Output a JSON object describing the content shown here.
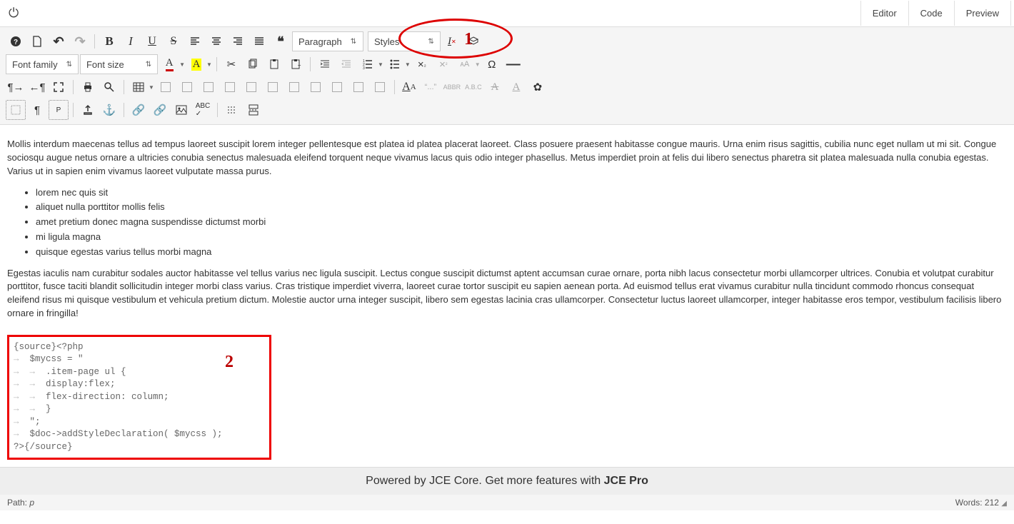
{
  "top": {
    "tabs": [
      "Editor",
      "Code",
      "Preview"
    ]
  },
  "toolbar": {
    "format_dropdown": "Paragraph",
    "styles_dropdown": "Styles",
    "font_family": "Font family",
    "font_size": "Font size",
    "abbr": "ABBR",
    "abc": "A.B.C",
    "quote_label": "“...”"
  },
  "annotations": {
    "circle_label": "1",
    "box_label": "2"
  },
  "content": {
    "para1": "Mollis interdum maecenas tellus ad tempus laoreet suscipit lorem integer pellentesque est platea id platea placerat laoreet. Class posuere praesent habitasse congue mauris. Urna enim risus sagittis, cubilia nunc eget nullam ut mi sit. Congue sociosqu augue netus ornare a ultricies conubia senectus malesuada eleifend torquent neque vivamus lacus quis odio integer phasellus. Metus imperdiet proin at felis dui libero senectus pharetra sit platea malesuada nulla conubia egestas. Varius ut in sapien enim vivamus laoreet vulputate massa purus.",
    "list": [
      "lorem nec quis sit",
      "aliquet nulla porttitor mollis felis",
      "amet pretium donec magna suspendisse dictumst morbi",
      "mi ligula magna",
      "quisque egestas varius tellus morbi magna"
    ],
    "para2": "Egestas iaculis nam curabitur sodales auctor habitasse vel tellus varius nec ligula suscipit. Lectus congue suscipit dictumst aptent accumsan curae ornare, porta nibh lacus consectetur morbi ullamcorper ultrices. Conubia et volutpat curabitur porttitor, fusce taciti blandit sollicitudin integer morbi class varius. Cras tristique imperdiet viverra, laoreet curae tortor suscipit eu sapien aenean porta. Ad euismod tellus erat vivamus curabitur nulla tincidunt commodo rhoncus consequat eleifend risus mi quisque vestibulum et vehicula pretium dictum. Molestie auctor urna integer suscipit, libero sem egestas lacinia cras ullamcorper. Consectetur luctus laoreet ullamcorper, integer habitasse eros tempor, vestibulum facilisis libero ornare in fringilla!",
    "source_lines": [
      "{source}<?php",
      "   $mycss = \"",
      "      .item-page ul {",
      "      display:flex;",
      "      flex-direction: column;",
      "      }",
      "   \";",
      "   $doc->addStyleDeclaration( $mycss );",
      "?>{/source}"
    ]
  },
  "footer": {
    "text_prefix": "Powered by JCE Core. Get more features with ",
    "text_bold": "JCE Pro"
  },
  "status": {
    "path_label": "Path:",
    "path_element": "p",
    "words_label": "Words:",
    "words_count": "212"
  }
}
